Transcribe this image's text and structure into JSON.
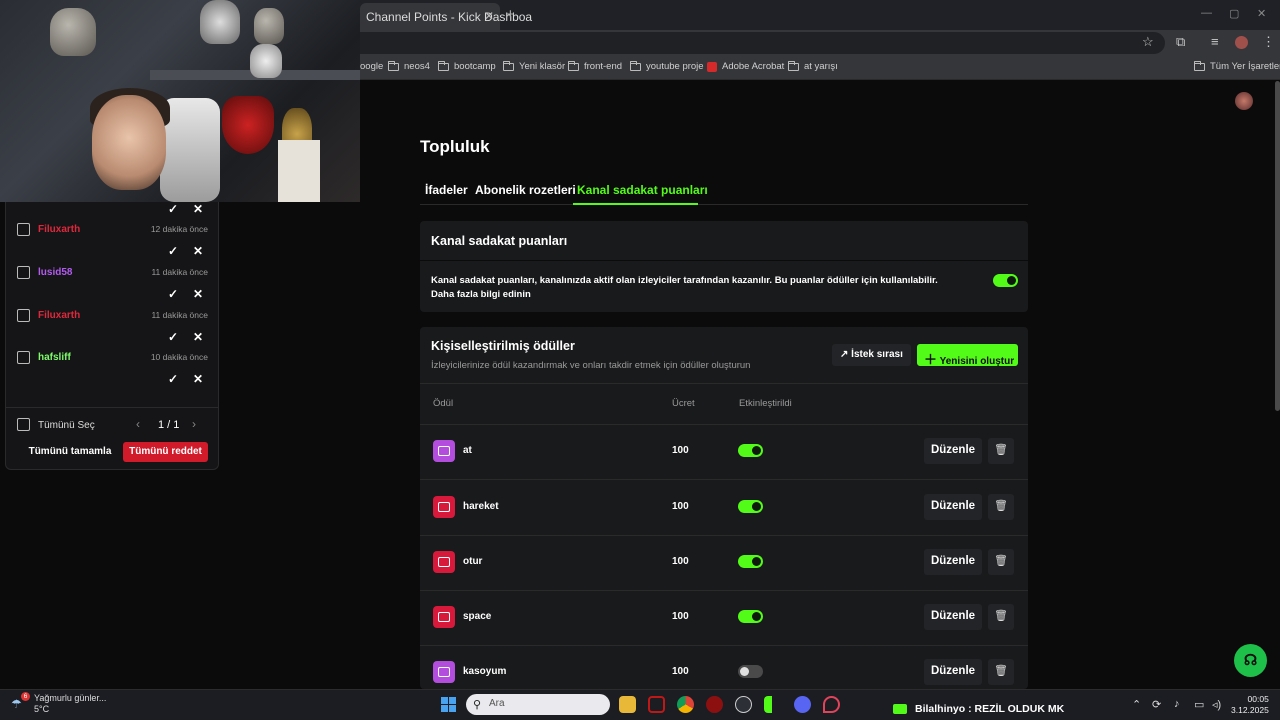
{
  "browser": {
    "tab_title": "Channel Points - Kick Dashboa",
    "new_tab": "+",
    "window_controls": [
      "—",
      "▢",
      "✕"
    ],
    "address_text": "",
    "bookmarks": [
      "oogle",
      "neos4",
      "bootcamp",
      "Yeni klasör",
      "front-end",
      "youtube proje",
      "Adobe Acrobat",
      "at yarışı"
    ],
    "bookmarks_all": "Tüm Yer İşaretleri"
  },
  "modpanel": {
    "rows": [
      {
        "user": "Filuxarth",
        "color": "#e0283c",
        "ago": "12 dakika önce"
      },
      {
        "user": "lusid58",
        "color": "#b35cf0",
        "ago": "11 dakika önce"
      },
      {
        "user": "Filuxarth",
        "color": "#e0283c",
        "ago": "11 dakika önce"
      },
      {
        "user": "hafsliff",
        "color": "#7dfc6a",
        "ago": "10 dakika önce"
      }
    ],
    "approve_glyph": "✓",
    "reject_glyph": "✕",
    "select_all": "Tümünü Seç",
    "pager": "1 / 1",
    "approve_all": "Tümünü tamamla",
    "reject_all": "Tümünü reddet"
  },
  "page": {
    "title": "Topluluk",
    "tabs": [
      "İfadeler",
      "Abonelik rozetleri",
      "Kanal sadakat puanları"
    ],
    "active_tab": 2,
    "accent": "#53fc18"
  },
  "loyalty": {
    "title": "Kanal sadakat puanları",
    "description": "Kanal sadakat puanları, kanalınızda aktif olan izleyiciler tarafından kazanılır. Bu puanlar ödüller için kullanılabilir.",
    "more_link": "Daha fazla bilgi edinin",
    "enabled": true
  },
  "rewards": {
    "title": "Kişiselleştirilmiş ödüller",
    "subtitle": "İzleyicilerinize ödül kazandırmak ve onları takdir etmek için ödüller oluşturun",
    "queue_button": "İstek sırası",
    "create_button": "Yenisini oluştur",
    "columns": [
      "Ödül",
      "Ücret",
      "Etkinleştirildi"
    ],
    "edit_label": "Düzenle",
    "items": [
      {
        "name": "at",
        "cost": "100",
        "enabled": true,
        "color": "#b24dde"
      },
      {
        "name": "hareket",
        "cost": "100",
        "enabled": true,
        "color": "#d7193c"
      },
      {
        "name": "otur",
        "cost": "100",
        "enabled": true,
        "color": "#d7193c"
      },
      {
        "name": "space",
        "cost": "100",
        "enabled": true,
        "color": "#d7193c"
      },
      {
        "name": "kasoyum",
        "cost": "100",
        "enabled": false,
        "color": "#b24dde"
      }
    ]
  },
  "taskbar": {
    "weather_title": "Yağmurlu günler...",
    "weather_temp": "5°C",
    "weather_badge": "6",
    "search_placeholder": "Ara",
    "now_playing_user": "Bilalhinyo",
    "now_playing_text": ": REZİL OLDUK MK",
    "time": "00:05",
    "date": "3.12.2025"
  }
}
